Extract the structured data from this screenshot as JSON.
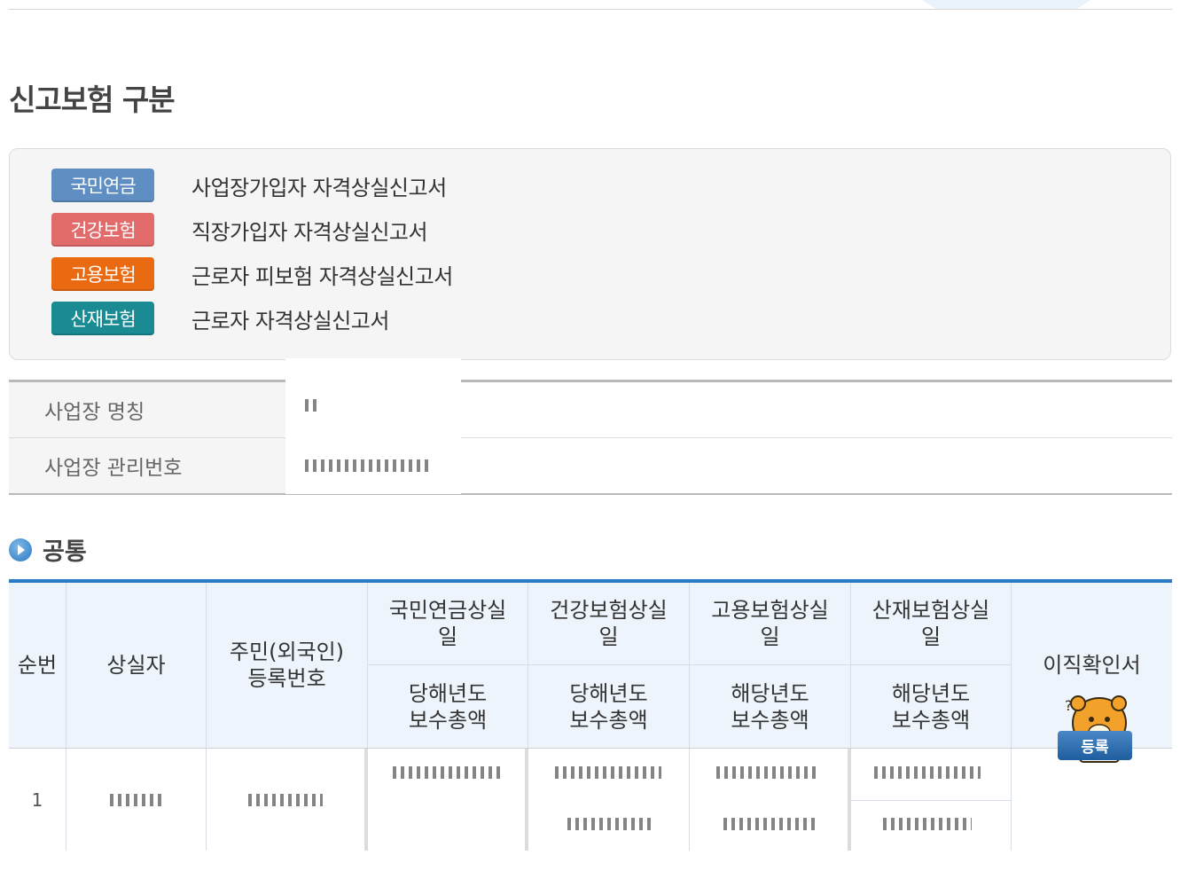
{
  "page": {
    "title": "신고보험 구분"
  },
  "insurance_types": [
    {
      "badge": "국민연금",
      "color": "#5f8fc2",
      "desc": "사업장가입자 자격상실신고서"
    },
    {
      "badge": "건강보험",
      "color": "#e26b6b",
      "desc": "직장가입자 자격상실신고서"
    },
    {
      "badge": "고용보험",
      "color": "#ea6a12",
      "desc": "근로자 피보험 자격상실신고서"
    },
    {
      "badge": "산재보험",
      "color": "#1a8b93",
      "desc": "근로자 자격상실신고서"
    }
  ],
  "workplace": {
    "name_label": "사업장 명칭",
    "name_value": "",
    "number_label": "사업장 관리번호",
    "number_value": ""
  },
  "section": {
    "title": "공통"
  },
  "table": {
    "headers": {
      "seq": "순번",
      "person": "상실자",
      "id": "주민(외국인)\n등록번호",
      "np_date": "국민연금상실\n일",
      "hi_date": "건강보험상실\n일",
      "ei_date": "고용보험상실\n일",
      "ia_date": "산재보험상실\n일",
      "hi_total": "당해년도\n보수총액",
      "hi_total2": "당해년도\n보수총액",
      "ei_total": "해당년도\n보수총액",
      "ia_total": "해당년도\n보수총액",
      "resign": "이직확인서"
    },
    "rows": [
      {
        "seq": "1",
        "register_label": "등록"
      }
    ]
  },
  "colors": {
    "accent": "#2a7bc4",
    "header_bg": "#eef4fb"
  }
}
